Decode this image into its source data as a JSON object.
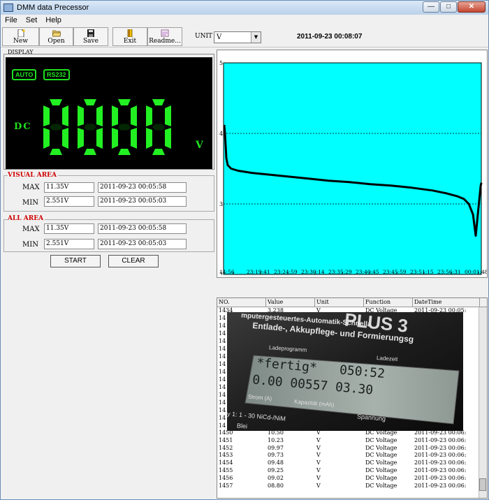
{
  "window": {
    "title": "DMM data Precessor"
  },
  "menu": [
    "File",
    "Set",
    "Help"
  ],
  "toolbar": {
    "buttons": [
      {
        "label": "New"
      },
      {
        "label": "Open"
      },
      {
        "label": "Save"
      },
      {
        "label": "Exit"
      },
      {
        "label": "Readme..."
      }
    ],
    "unit_label": "UNIT",
    "unit_value": "V",
    "datetime": "2011-09-23 00:08:07"
  },
  "display": {
    "group_label": "DISPLAY",
    "badges": [
      "AUTO",
      "RS232"
    ],
    "mode": "DC",
    "reading": "0000",
    "unit": "V"
  },
  "visual_area": {
    "title": "VISUAL AREA",
    "max_label": "MAX",
    "min_label": "MIN",
    "max_value": "11.35V",
    "max_time": "2011-09-23 00:05:58",
    "min_value": "2.551V",
    "min_time": "2011-09-23 00:05:03"
  },
  "all_area": {
    "title": "ALL AREA",
    "max_label": "MAX",
    "min_label": "MIN",
    "max_value": "11.35V",
    "max_time": "2011-09-23 00:05:58",
    "min_value": "2.551V",
    "min_time": "2011-09-23 00:05:03"
  },
  "buttons": {
    "start": "START",
    "clear": "CLEAR"
  },
  "chart_data": {
    "type": "line",
    "background": "#00ffff",
    "ylim": [
      2,
      5
    ],
    "yticks": [
      "5",
      "4",
      "3",
      "2"
    ],
    "xticks": [
      "14:56",
      "23:19:41",
      "23:24:59",
      "23:30:14",
      "23:35:29",
      "23:40:45",
      "23:45:59",
      "23:51:15",
      "23:56:31",
      "00:01:48"
    ],
    "grid": true,
    "series": [
      {
        "x": [
          0,
          1,
          3,
          5,
          10,
          20,
          40,
          60,
          80,
          100,
          120,
          150,
          180,
          210,
          240,
          270,
          300,
          320,
          335,
          345,
          352,
          358,
          362,
          366,
          369,
          370
        ],
        "values": [
          4.12,
          4.0,
          3.65,
          3.55,
          3.5,
          3.47,
          3.44,
          3.42,
          3.4,
          3.38,
          3.36,
          3.33,
          3.31,
          3.28,
          3.26,
          3.23,
          3.19,
          3.15,
          3.11,
          3.07,
          3.0,
          2.85,
          2.55,
          2.95,
          3.25,
          3.3
        ]
      }
    ]
  },
  "table": {
    "columns": [
      "NO.",
      "Value",
      "Unit",
      "Function",
      "DateTime"
    ],
    "rows": [
      [
        "1434",
        "3.238",
        "V",
        "DC Voltage",
        "2011-09-23 00:05:"
      ],
      [
        "1450",
        "10.50",
        "V",
        "DC Voltage",
        "2011-09-23 00:06:"
      ],
      [
        "1451",
        "10.23",
        "V",
        "DC Voltage",
        "2011-09-23 00:06:"
      ],
      [
        "1452",
        "09.97",
        "V",
        "DC Voltage",
        "2011-09-23 00:06:"
      ],
      [
        "1453",
        "09.73",
        "V",
        "DC Voltage",
        "2011-09-23 00:06:"
      ],
      [
        "1454",
        "09.48",
        "V",
        "DC Voltage",
        "2011-09-23 00:06:"
      ],
      [
        "1455",
        "09.25",
        "V",
        "DC Voltage",
        "2011-09-23 00:06:"
      ],
      [
        "1456",
        "09.02",
        "V",
        "DC Voltage",
        "2011-09-23 00:06:"
      ],
      [
        "1457",
        "08.80",
        "V",
        "DC Voltage",
        "2011-09-23 00:06:"
      ]
    ],
    "hidden_rows_prefix": "14"
  },
  "photo": {
    "header_line1": "mputergesteuertes-Automatik-Schnella",
    "header_line2": "Entlade-, Akkupflege- und Formierungsg",
    "brand_fragment": "PLUS 3",
    "label_program": "Ladeprogramm",
    "label_time": "Ladezeit",
    "lcd_line1": "*fertig*   050:52",
    "lcd_line2": "0.00 00557 03.30",
    "label_current": "Strom (A)",
    "label_capacity": "Kapazität (mAh)",
    "label_voltage": "Spannung",
    "footer_text": "y 1:  1 - 30 NiCd-/NiM",
    "footer_text2": "Blei"
  }
}
